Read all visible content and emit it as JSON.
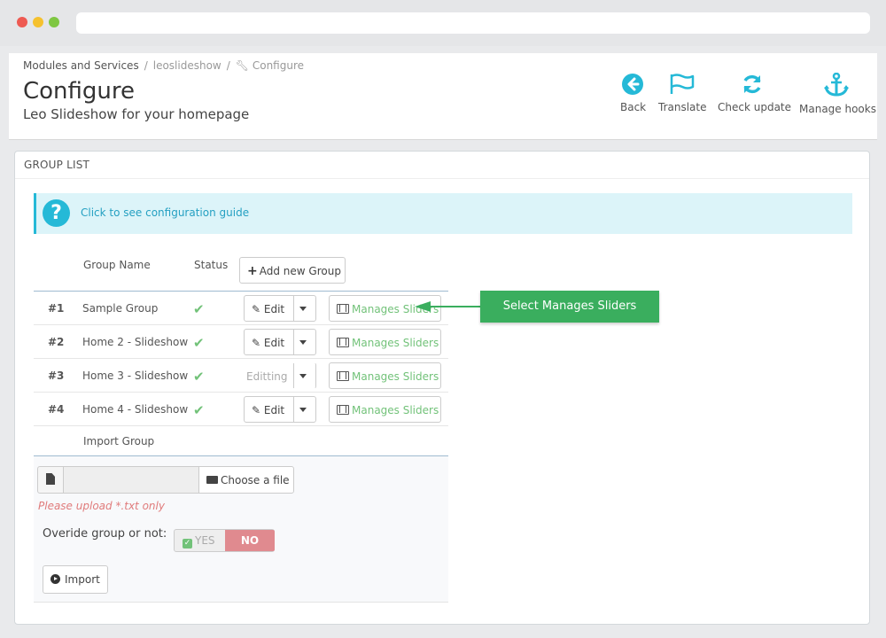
{
  "breadcrumb": {
    "items": [
      "Modules and Services",
      "leoslideshow",
      "Configure"
    ],
    "separator": "/"
  },
  "page": {
    "title": "Configure",
    "subtitle": "Leo Slideshow for your homepage"
  },
  "toolbar": {
    "back": "Back",
    "translate": "Translate",
    "check_update": "Check update",
    "manage_hooks": "Manage hooks",
    "icon_color": "#25b9d7"
  },
  "panel": {
    "heading": "GROUP LIST",
    "guide_icon": "?",
    "guide_link": "Click to see configuration guide"
  },
  "table": {
    "col_name": "Group Name",
    "col_status": "Status",
    "add_button": "Add new Group",
    "rows": [
      {
        "num": "#1",
        "name": "Sample Group",
        "status": "✔",
        "action": "Edit",
        "manage": "Manages Sliders"
      },
      {
        "num": "#2",
        "name": "Home 2 - Slideshow",
        "status": "✔",
        "action": "Edit",
        "manage": "Manages Sliders"
      },
      {
        "num": "#3",
        "name": "Home 3 - Slideshow",
        "status": "✔",
        "action": "Editting",
        "manage": "Manages Sliders"
      },
      {
        "num": "#4",
        "name": "Home 4 - Slideshow",
        "status": "✔",
        "action": "Edit",
        "manage": "Manages Sliders"
      }
    ]
  },
  "import": {
    "title": "Import Group",
    "choose_file": "Choose a file",
    "hint": "Please upload *.txt only",
    "override_label": "Overide group or not:",
    "yes": "YES",
    "no": "NO",
    "import_button": "Import"
  },
  "annotation": {
    "text": "Select Manages Sliders",
    "color": "#3aae5e"
  }
}
